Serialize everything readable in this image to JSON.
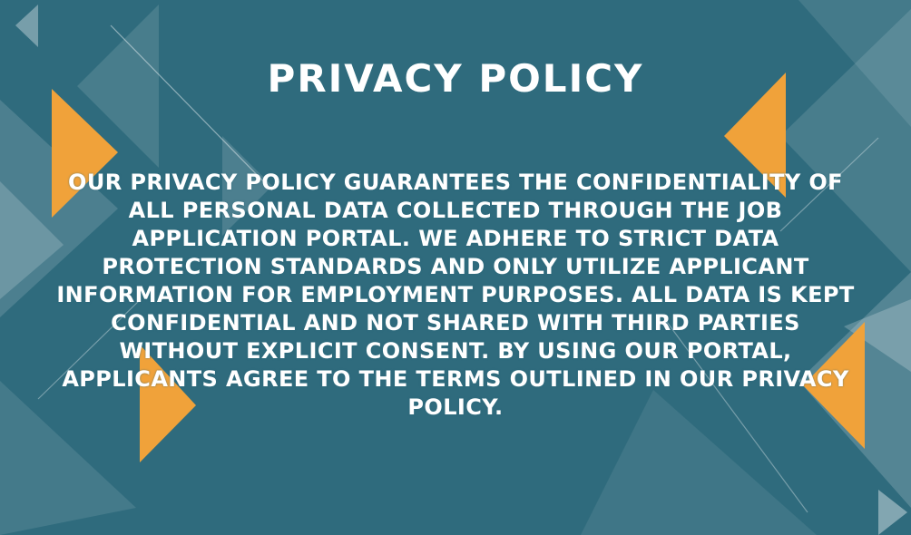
{
  "colors": {
    "background": "#2f6b7d",
    "accent": "#f0a23a",
    "text": "#ffffff"
  },
  "page": {
    "title": "PRIVACY POLICY",
    "body": "OUR PRIVACY POLICY GUARANTEES THE CONFIDENTIALITY OF ALL PERSONAL DATA COLLECTED THROUGH THE JOB APPLICATION PORTAL. WE ADHERE TO STRICT DATA PROTECTION STANDARDS AND ONLY UTILIZE APPLICANT INFORMATION FOR EMPLOYMENT PURPOSES. ALL DATA IS KEPT CONFIDENTIAL AND NOT SHARED WITH THIRD PARTIES WITHOUT EXPLICIT CONSENT. BY USING OUR PORTAL, APPLICANTS AGREE TO THE TERMS OUTLINED IN OUR PRIVACY POLICY."
  }
}
